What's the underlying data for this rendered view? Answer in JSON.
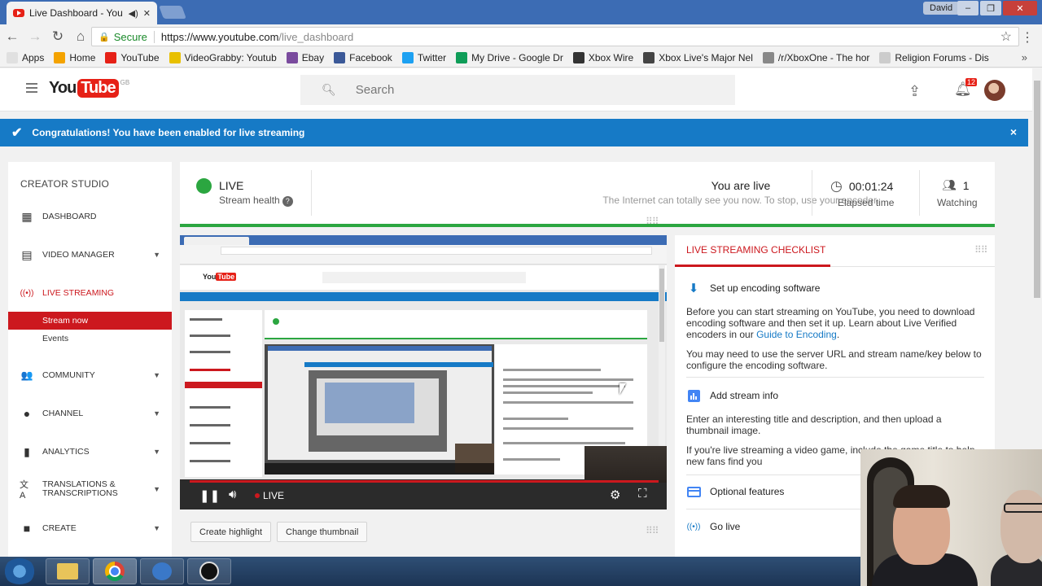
{
  "browser": {
    "tab_title": "Live Dashboard - You",
    "tab_audio": "◀)",
    "tab_close": "✕",
    "user": "David",
    "secure_label": "Secure",
    "url_host": "https://www.youtube.com",
    "url_path": "/live_dashboard",
    "bookmarks": [
      {
        "label": "Apps",
        "color": "#e0e0e0"
      },
      {
        "label": "Home",
        "color": "#f4a300"
      },
      {
        "label": "YouTube",
        "color": "#e62117"
      },
      {
        "label": "VideoGrabby: Youtub",
        "color": "#e8c000"
      },
      {
        "label": "Ebay",
        "color": "#7a4b9e"
      },
      {
        "label": "Facebook",
        "color": "#3b5998"
      },
      {
        "label": "Twitter",
        "color": "#1da1f2"
      },
      {
        "label": "My Drive - Google Dr",
        "color": "#0f9d58"
      },
      {
        "label": "Xbox Wire",
        "color": "#333333"
      },
      {
        "label": "Xbox Live's Major Nel",
        "color": "#444444"
      },
      {
        "label": "/r/XboxOne - The hor",
        "color": "#888888"
      },
      {
        "label": "Religion Forums - Dis",
        "color": "#cccccc"
      }
    ],
    "bookmarks_more": "»"
  },
  "youtube": {
    "logo_you": "You",
    "logo_tube": "Tube",
    "logo_region": "GB",
    "search_placeholder": "Search",
    "notification_count": "12"
  },
  "alert": {
    "message": "Congratulations! You have been enabled for live streaming",
    "close": "×"
  },
  "sidebar": {
    "heading": "CREATOR STUDIO",
    "items": [
      {
        "label": "DASHBOARD",
        "icon": "▦"
      },
      {
        "label": "VIDEO MANAGER",
        "icon": "▤"
      },
      {
        "label": "LIVE STREAMING",
        "icon": "((•))"
      },
      {
        "label": "COMMUNITY",
        "icon": "👥"
      },
      {
        "label": "CHANNEL",
        "icon": "●"
      },
      {
        "label": "ANALYTICS",
        "icon": "▮"
      },
      {
        "label": "TRANSLATIONS & TRANSCRIPTIONS",
        "icon": "文A"
      },
      {
        "label": "CREATE",
        "icon": "■"
      }
    ],
    "sub_items": [
      {
        "label": "Stream now"
      },
      {
        "label": "Events"
      }
    ]
  },
  "status": {
    "live_label": "LIVE",
    "health_label": "Stream health",
    "title": "You are live",
    "subtitle": "The Internet can totally see you now. To stop, use your encoder.",
    "elapsed_value": "00:01:24",
    "elapsed_label": "Elapsed time",
    "watching_value": "1",
    "watching_label": "Watching"
  },
  "player": {
    "live_label": "LIVE",
    "progress": 1.0
  },
  "actions": {
    "create_highlight": "Create highlight",
    "change_thumbnail": "Change thumbnail"
  },
  "checklist": {
    "title": "LIVE STREAMING CHECKLIST",
    "step1_title": "Set up encoding software",
    "step1_p1a": "Before you can start streaming on YouTube, you need to download encoding software and then set it up. Learn about Live Verified encoders in our ",
    "step1_p1_link": "Guide to Encoding",
    "step1_p1b": ".",
    "step1_p2": "You may need to use the server URL and stream name/key below to configure the encoding software.",
    "step2_title": "Add stream info",
    "step2_p1": "Enter an interesting title and description, and then upload a thumbnail image.",
    "step2_p2": "If you're live streaming a video game, include the game title to help new fans find you",
    "step3_title": "Optional features",
    "step4_title": "Go live"
  },
  "colors": {
    "youtube_red": "#cc181e",
    "live_green": "#2ba640",
    "alert_blue": "#167ac6"
  }
}
